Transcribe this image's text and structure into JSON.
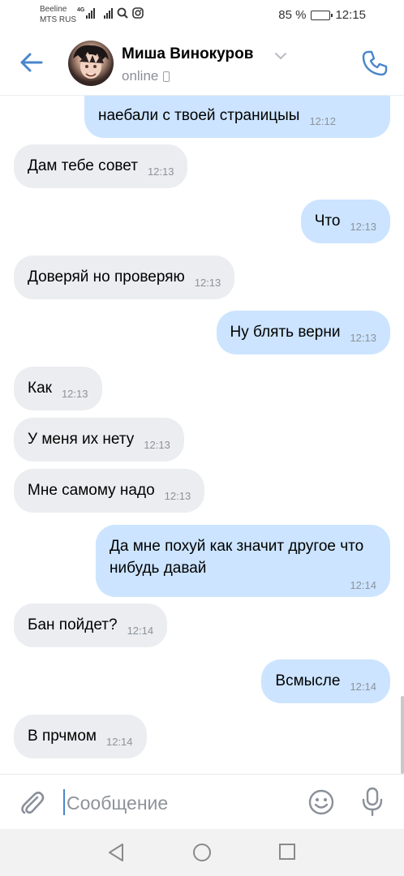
{
  "status_bar": {
    "carrier1": "Beeline",
    "carrier2": "MTS RUS",
    "net_type": "4G",
    "battery": "85 %",
    "battery_level": 0.85,
    "time": "12:15"
  },
  "header": {
    "contact_name": "Миша Винокуров",
    "status": "online",
    "icons": {
      "back": "arrow-left-icon",
      "call": "phone-icon",
      "dropdown": "chevron-down-icon"
    }
  },
  "messages": [
    {
      "dir": "out",
      "text": "наебали с твоей страницыы",
      "time": "12:12"
    },
    {
      "dir": "in",
      "text": "Дам тебе совет",
      "time": "12:13"
    },
    {
      "dir": "out",
      "text": "Что",
      "time": "12:13"
    },
    {
      "dir": "in",
      "text": "Доверяй но проверяю",
      "time": "12:13"
    },
    {
      "dir": "out",
      "text": "Ну блять верни",
      "time": "12:13"
    },
    {
      "dir": "in",
      "text": "Как",
      "time": "12:13"
    },
    {
      "dir": "in",
      "text": "У меня их нету",
      "time": "12:13"
    },
    {
      "dir": "in",
      "text": "Мне самому надо",
      "time": "12:13"
    },
    {
      "dir": "out",
      "text": "Да мне похуй как значит другое что нибудь давай",
      "time": "12:14"
    },
    {
      "dir": "in",
      "text": "Бан пойдет?",
      "time": "12:14"
    },
    {
      "dir": "out",
      "text": "Всмысле",
      "time": "12:14"
    },
    {
      "dir": "in",
      "text": "В прчмом",
      "time": "12:14"
    }
  ],
  "composer": {
    "placeholder": "Сообщение",
    "value": "",
    "icons": {
      "attach": "paperclip-icon",
      "emoji": "smile-icon",
      "voice": "microphone-icon"
    }
  },
  "nav": {
    "icons": [
      "back-triangle-icon",
      "home-circle-icon",
      "recents-square-icon"
    ]
  },
  "colors": {
    "accent": "#4986cc",
    "bubble_in": "#ebedf0",
    "bubble_out": "#cce4ff",
    "time_text": "#8c939c"
  }
}
